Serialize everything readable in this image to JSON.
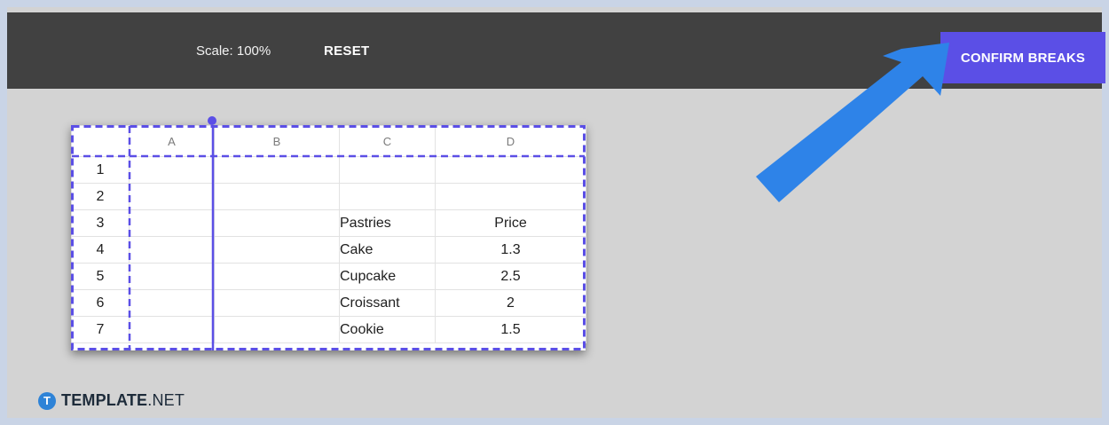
{
  "toolbar": {
    "scale_label": "Scale: 100%",
    "reset_label": "RESET",
    "confirm_label": "CONFIRM BREAKS"
  },
  "sheet": {
    "columns": [
      "A",
      "B",
      "C",
      "D"
    ],
    "rows": [
      {
        "num": "1",
        "a": "",
        "b": "",
        "c": "",
        "d": ""
      },
      {
        "num": "2",
        "a": "",
        "b": "",
        "c": "",
        "d": ""
      },
      {
        "num": "3",
        "a": "",
        "b": "",
        "c": "Pastries",
        "d": "Price"
      },
      {
        "num": "4",
        "a": "",
        "b": "",
        "c": "Cake",
        "d": "1.3"
      },
      {
        "num": "5",
        "a": "",
        "b": "",
        "c": "Cupcake",
        "d": "2.5"
      },
      {
        "num": "6",
        "a": "",
        "b": "",
        "c": "Croissant",
        "d": "2"
      },
      {
        "num": "7",
        "a": "",
        "b": "",
        "c": "Cookie",
        "d": "1.5"
      }
    ]
  },
  "logo": {
    "mark": "T",
    "brand": "TEMPLATE",
    "suffix": ".NET"
  },
  "colors": {
    "toolbar_bg": "#414141",
    "accent": "#5b4fe6",
    "arrow": "#2e83e8",
    "canvas_bg": "#d3d3d3"
  },
  "icons": {
    "arrow": "pointer-arrow-icon",
    "handle": "page-break-handle-icon"
  }
}
